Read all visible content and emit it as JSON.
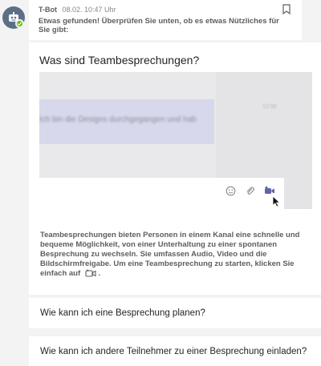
{
  "message": {
    "sender": "T-Bot",
    "timestamp": "08.02. 10:47 Uhr",
    "intro": "Etwas gefunden! Überprüfen Sie unten, ob es etwas Nützliches für Sie gibt:"
  },
  "card": {
    "title": "Was sind Teambesprechungen?",
    "preview": {
      "bubble_text": "Ich bin die Designs durchgegangen und hab",
      "time": "12:00"
    },
    "description": "Teambesprechungen bieten Personen in einem Kanal eine schnelle und bequeme Möglichkeit, von einer Unterhaltung zu einer spontanen Besprechung zu wechseln. Sie umfassen Audio, Video und die Bildschirmfreigabe. Um eine Teambesprechung zu starten, klicken Sie einfach auf",
    "description_end": "."
  },
  "questions": [
    "Wie kann ich eine Besprechung planen?",
    "Wie kann ich andere Teilnehmer zu einer Besprechung einladen?"
  ],
  "colors": {
    "presence": "#6bb700",
    "accent": "#6264a7",
    "avatar": "#5c6f85"
  },
  "icons": [
    "bot-icon",
    "checkmark-icon",
    "bookmark-icon",
    "emoji-icon",
    "attach-icon",
    "meet-now-icon",
    "cursor-icon",
    "video-camera-icon"
  ]
}
